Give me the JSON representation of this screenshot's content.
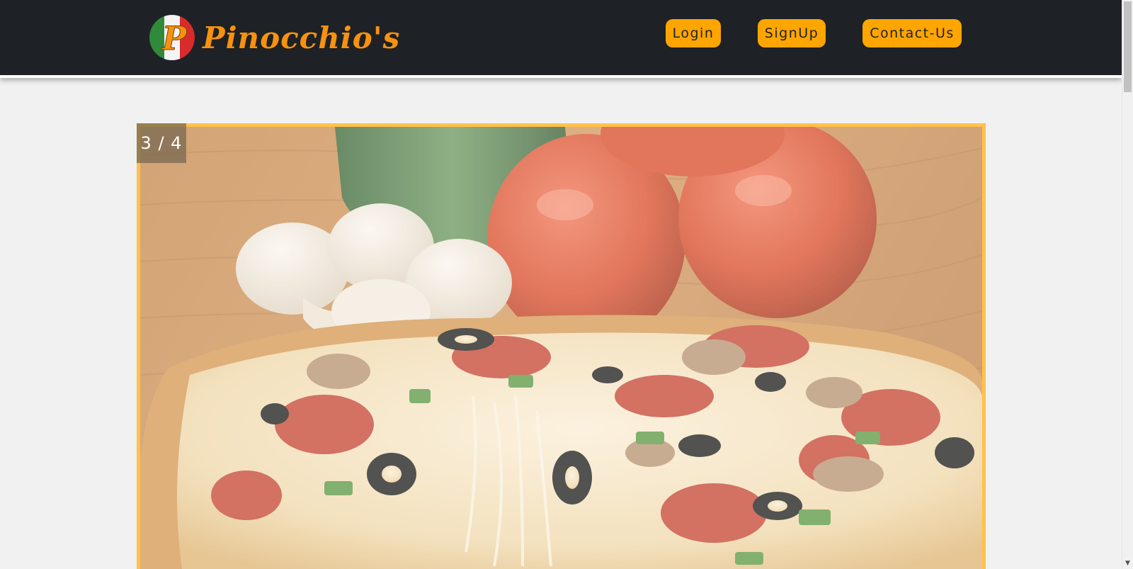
{
  "brand": {
    "name": "Pinocchio's",
    "logo_letter": "P",
    "logo_icon": "italian-flag-logo-icon",
    "color": "#f7920e"
  },
  "nav": {
    "login_label": "Login",
    "signup_label": "SignUp",
    "contact_label": "Contact-Us",
    "button_color": "#ffa500",
    "background": "#1e2126"
  },
  "slideshow": {
    "counter": "3 / 4",
    "current": 3,
    "total": 4,
    "image_subject": "pizza-with-mushrooms-tomatoes-peppers",
    "border_color": "#ffc24a"
  },
  "scrollbar": {
    "down_arrow_icon": "chevron-down-icon"
  }
}
